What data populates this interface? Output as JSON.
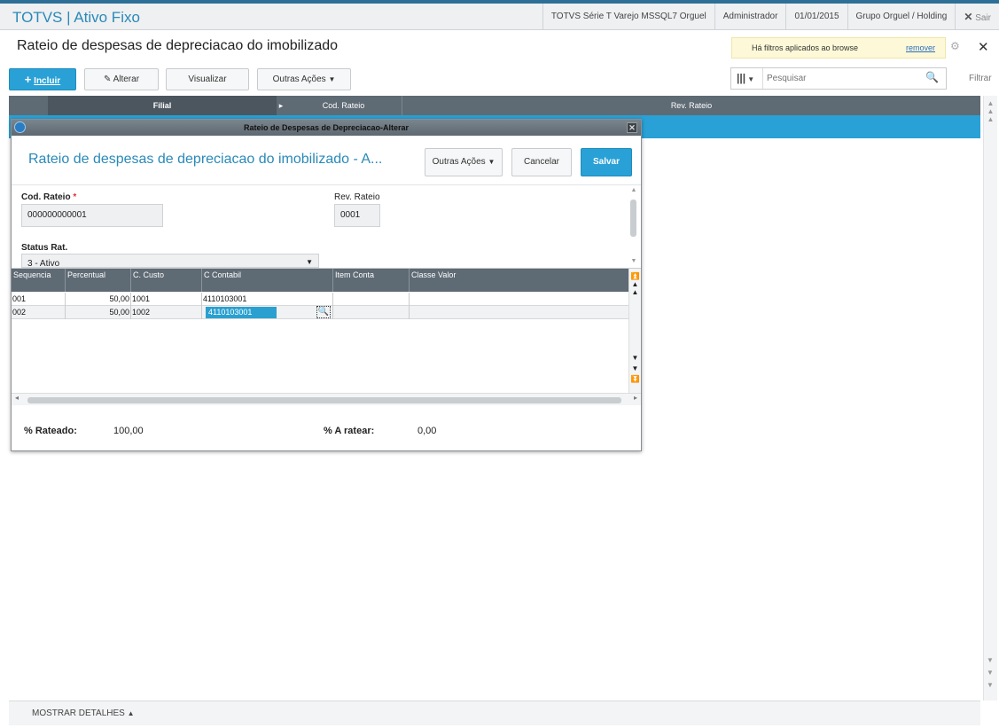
{
  "app": {
    "title": "TOTVS | Ativo Fixo",
    "env": "TOTVS Série T Varejo MSSQL7 Orguel",
    "user": "Administrador",
    "date": "01/01/2015",
    "company": "Grupo Orguel / Holding",
    "exit_label": "Sair"
  },
  "page": {
    "title": "Rateio de despesas de depreciacao do imobilizado",
    "filter_note": "Há filtros aplicados ao browse",
    "filter_remove": "remover"
  },
  "toolbar": {
    "include": "Incluir",
    "alter": "Alterar",
    "view": "Visualizar",
    "more": "Outras Ações"
  },
  "search": {
    "placeholder": "Pesquisar"
  },
  "filter_label": "Filtrar",
  "browse": {
    "columns": [
      "Filial",
      "Cod. Rateio",
      "Rev. Rateio"
    ]
  },
  "footer": {
    "details": "MOSTRAR DETALHES"
  },
  "modal": {
    "window_title": "Rateio de Despesas de Depreciacao-Alterar",
    "heading": "Rateio de despesas de depreciacao do imobilizado - A...",
    "btn_more": "Outras Ações",
    "btn_cancel": "Cancelar",
    "btn_save": "Salvar",
    "fields": {
      "cod_rateio_label": "Cod. Rateio",
      "cod_rateio_value": "000000000001",
      "rev_rateio_label": "Rev. Rateio",
      "rev_rateio_value": "0001",
      "status_label": "Status Rat.",
      "status_value": "3 - Ativo"
    },
    "grid": {
      "columns": [
        "Sequencia",
        "Percentual",
        "C. Custo",
        "C Contabil",
        "Item Conta",
        "Classe Valor"
      ],
      "rows": [
        {
          "seq": "001",
          "pct": "50,00",
          "cc": "1001",
          "conta": "4110103001"
        },
        {
          "seq": "002",
          "pct": "50,00",
          "cc": "1002",
          "conta": "4110103001"
        }
      ]
    },
    "totals": {
      "rateado_label": "% Rateado:",
      "rateado_value": "100,00",
      "a_ratear_label": "% A ratear:",
      "a_ratear_value": "0,00"
    }
  }
}
